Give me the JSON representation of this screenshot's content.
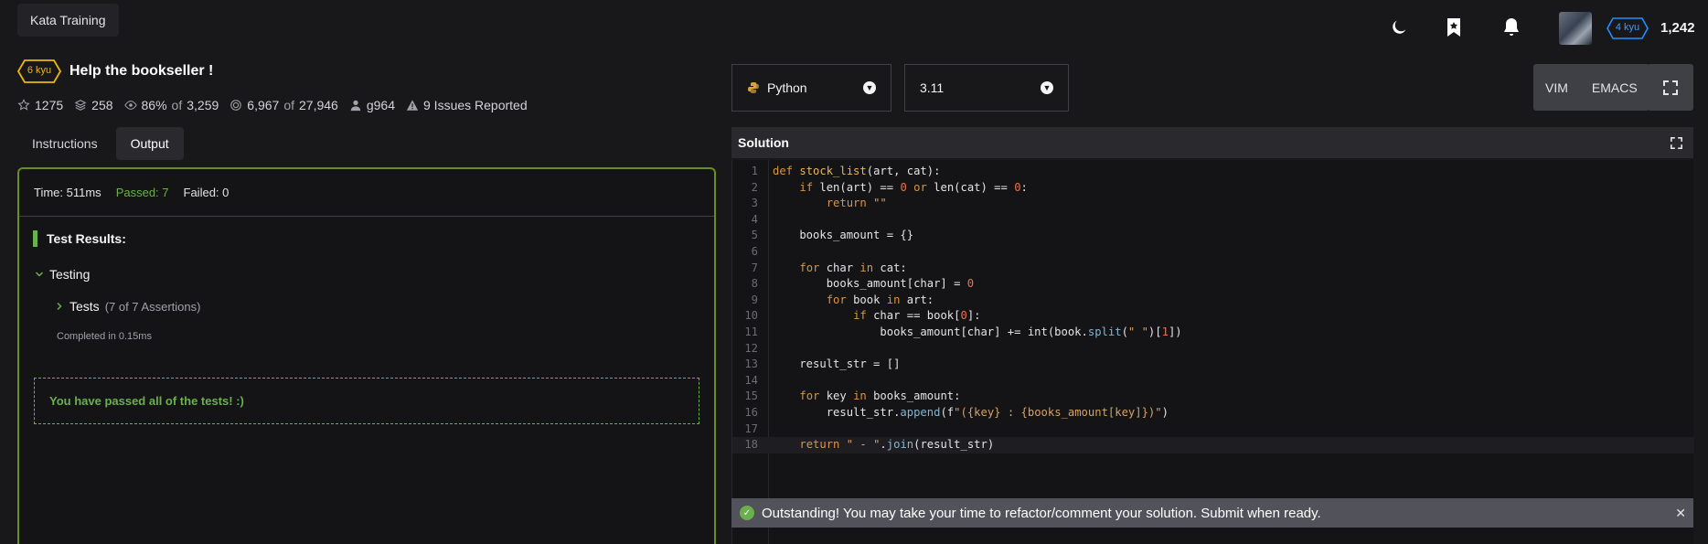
{
  "app": {
    "title": "Kata Training"
  },
  "user": {
    "rank": "4 kyu",
    "honor": "1,242",
    "rank_color": "#1e90ff"
  },
  "kata": {
    "rank": "6 kyu",
    "rank_color": "#ecb613",
    "title": "Help the bookseller !",
    "stats": {
      "stars": "1275",
      "collections": "258",
      "satisfaction_pct": "86%",
      "satisfaction_of": "of",
      "satisfaction_total": "3,259",
      "completed": "6,967",
      "completed_of": "of",
      "completed_total": "27,946",
      "author": "g964",
      "issues": "9 Issues Reported"
    }
  },
  "tabs": [
    "Instructions",
    "Output"
  ],
  "output": {
    "time": "Time: 511ms",
    "passed": "Passed: 7",
    "failed": "Failed: 0",
    "results_title": "Test Results:",
    "group": "Testing",
    "tests_label": "Tests",
    "tests_assertions": "(7 of 7 Assertions)",
    "completed": "Completed in 0.15ms",
    "pass_message": "You have passed all of the tests! :)"
  },
  "editor": {
    "language": "Python",
    "version": "3.11",
    "modes": [
      "VIM",
      "EMACS"
    ],
    "solution_title": "Solution",
    "code": [
      [
        [
          "kw",
          "def "
        ],
        [
          "fn",
          "stock_list"
        ],
        [
          "t",
          "(art, cat):"
        ]
      ],
      [
        [
          "t",
          "    "
        ],
        [
          "kw",
          "if "
        ],
        [
          "t",
          "len(art) == "
        ],
        [
          "num",
          "0"
        ],
        [
          "kw",
          " or "
        ],
        [
          "t",
          "len(cat) == "
        ],
        [
          "num",
          "0"
        ],
        [
          "t",
          ":"
        ]
      ],
      [
        [
          "t",
          "        "
        ],
        [
          "kw",
          "return "
        ],
        [
          "str",
          "\"\""
        ]
      ],
      [],
      [
        [
          "t",
          "    books_amount = {}"
        ]
      ],
      [],
      [
        [
          "t",
          "    "
        ],
        [
          "kw",
          "for "
        ],
        [
          "t",
          "char "
        ],
        [
          "kw",
          "in "
        ],
        [
          "t",
          "cat:"
        ]
      ],
      [
        [
          "t",
          "        books_amount[char] = "
        ],
        [
          "num",
          "0"
        ]
      ],
      [
        [
          "t",
          "        "
        ],
        [
          "kw",
          "for "
        ],
        [
          "t",
          "book "
        ],
        [
          "kw",
          "in "
        ],
        [
          "t",
          "art:"
        ]
      ],
      [
        [
          "t",
          "            "
        ],
        [
          "kw",
          "if "
        ],
        [
          "t",
          "char == book["
        ],
        [
          "num",
          "0"
        ],
        [
          "t",
          "]:"
        ]
      ],
      [
        [
          "t",
          "                books_amount[char] += int(book."
        ],
        [
          "meth",
          "split"
        ],
        [
          "t",
          "("
        ],
        [
          "str",
          "\" \""
        ],
        [
          "t",
          ")["
        ],
        [
          "num",
          "1"
        ],
        [
          "t",
          "])"
        ]
      ],
      [],
      [
        [
          "t",
          "    result_str = []"
        ]
      ],
      [],
      [
        [
          "t",
          "    "
        ],
        [
          "kw",
          "for "
        ],
        [
          "t",
          "key "
        ],
        [
          "kw",
          "in "
        ],
        [
          "t",
          "books_amount:"
        ]
      ],
      [
        [
          "t",
          "        result_str."
        ],
        [
          "meth",
          "append"
        ],
        [
          "t",
          "(f"
        ],
        [
          "str",
          "\"({key} : {books_amount[key]})\""
        ],
        [
          "t",
          ")"
        ]
      ],
      [],
      [
        [
          "t",
          "    "
        ],
        [
          "kw",
          "return "
        ],
        [
          "str",
          "\" - \""
        ],
        [
          "t",
          "."
        ],
        [
          "meth",
          "join"
        ],
        [
          "t",
          "(result_str)"
        ]
      ]
    ],
    "current_line": 18,
    "notification": "Outstanding! You may take your time to refactor/comment your solution. Submit when ready."
  }
}
